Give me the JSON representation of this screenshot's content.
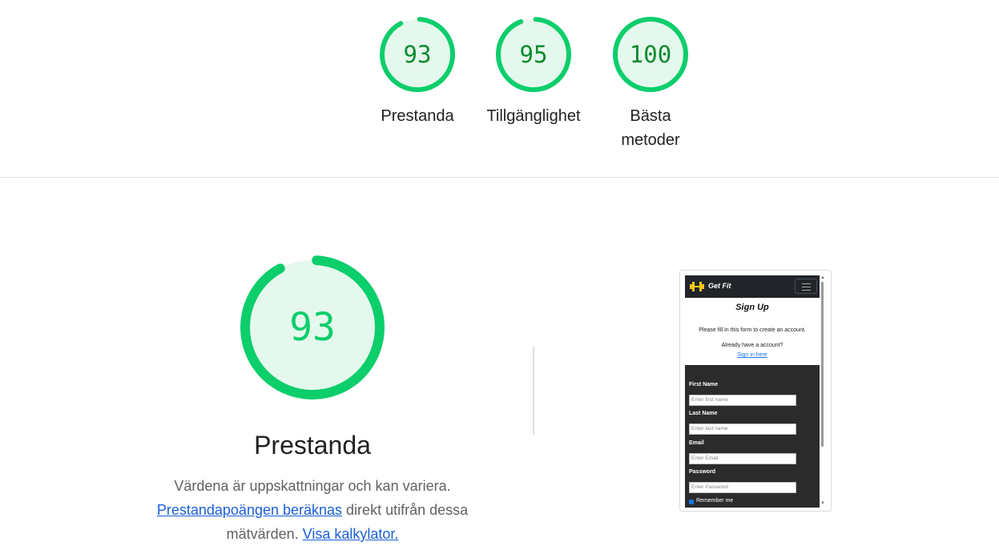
{
  "colors": {
    "pass_green": "#0cce6b",
    "pass_green_dark": "#0c8a2e",
    "pass_fill": "#e5f8ed",
    "link": "#1a5fd6"
  },
  "top_scores": [
    {
      "value": 93,
      "score_fraction": 0.93,
      "label": "Prestanda"
    },
    {
      "value": 95,
      "score_fraction": 0.95,
      "label": "Tillgänglighet"
    },
    {
      "value": 100,
      "score_fraction": 1.0,
      "label": "Bästa metoder"
    }
  ],
  "performance": {
    "score": 93,
    "score_fraction": 0.93,
    "title": "Prestanda",
    "desc_text_1": "Värdena är uppskattningar och kan variera.",
    "desc_link_1": "Prestandapoängen beräknas",
    "desc_text_2": " direkt utifrån dessa mätvärden.",
    "desc_link_2": "Visa kalkylator."
  },
  "screenshot": {
    "brand": "Get Fit",
    "heading": "Sign Up",
    "subtitle": "Please fill in this form to create an account.",
    "already": "Already have a account?",
    "signin_link": "Sign in here",
    "fields": [
      {
        "label": "First Name",
        "placeholder": "Enter first name"
      },
      {
        "label": "Last Name",
        "placeholder": "Enter last name"
      },
      {
        "label": "Email",
        "placeholder": "Enter Email"
      },
      {
        "label": "Password",
        "placeholder": "Enter Password"
      }
    ],
    "remember": "Remember me"
  }
}
